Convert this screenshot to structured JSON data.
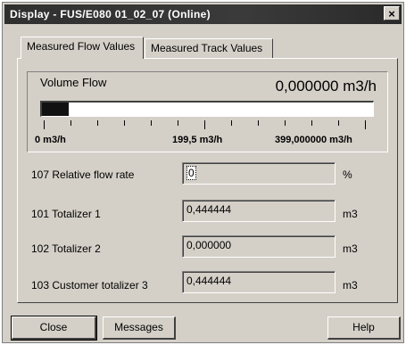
{
  "window": {
    "title": "Display - FUS/E080 01_02_07 (Online)",
    "close_glyph": "×"
  },
  "tabs": [
    {
      "label": "Measured Flow Values",
      "active": true
    },
    {
      "label": "Measured Track Values",
      "active": false
    }
  ],
  "flow": {
    "label": "Volume Flow",
    "value": "0,000000 m3/h",
    "bar_fill_fraction": 0.08,
    "scale": {
      "min": "0 m3/h",
      "mid": "199,5 m3/h",
      "max": "399,000000 m3/h"
    }
  },
  "rows": [
    {
      "label": "107  Relative flow rate",
      "value": "0",
      "unit": "%"
    },
    {
      "label": "101  Totalizer 1",
      "value": "0,444444",
      "unit": "m3"
    },
    {
      "label": "102  Totalizer 2",
      "value": "0,000000",
      "unit": "m3"
    },
    {
      "label": "103  Customer totalizer 3",
      "value": "0,444444",
      "unit": "m3"
    }
  ],
  "buttons": {
    "close": "Close",
    "messages": "Messages",
    "help": "Help"
  }
}
